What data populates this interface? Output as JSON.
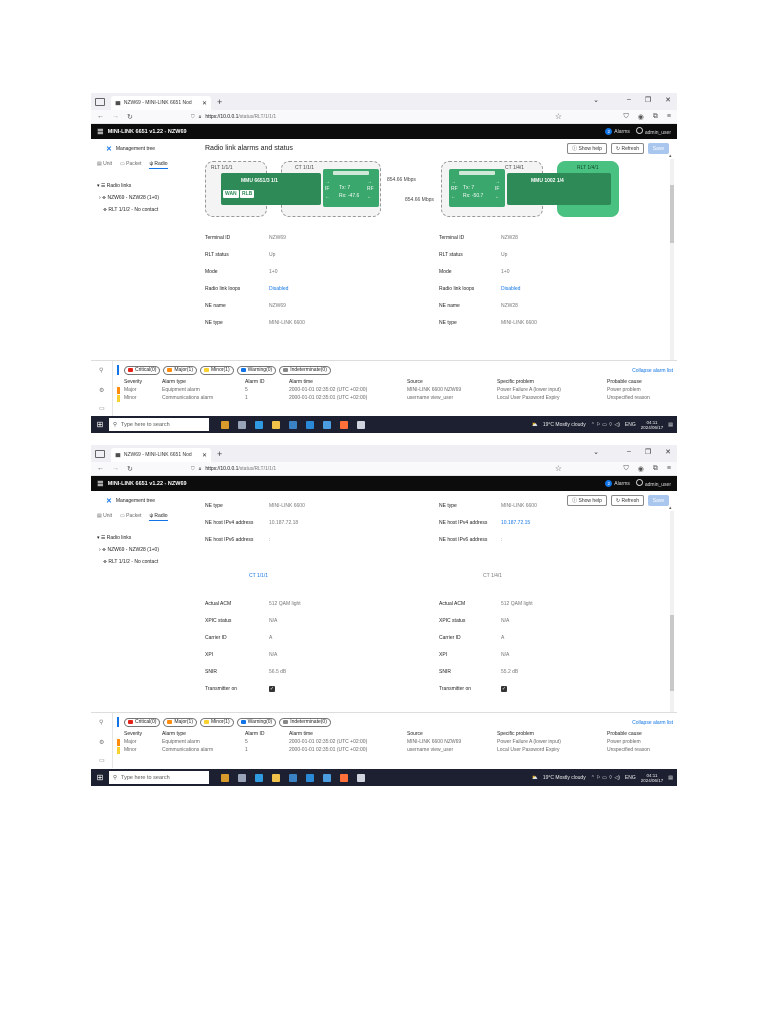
{
  "browser": {
    "tab_title": "NZW69 - MINI-LINK 6651 Nod",
    "url_host": "https://10.0.0.1",
    "url_path": "/status/RLT/1/1/1"
  },
  "app": {
    "logo": "≣",
    "title": "MINI-LINK 6651 v1.22 - NZW69",
    "alarms_label": "Alarms",
    "alarms_count": "2",
    "user": "admin_user"
  },
  "sidebar": {
    "management_tree": "Management tree",
    "tabs": [
      "Unit",
      "Packet",
      "Radio"
    ],
    "tree": [
      "Radio links",
      "NZW69 - NZW28 (1+0)",
      "RLT 1/1/2 - No contact"
    ]
  },
  "page": {
    "title": "Radio link alarms and status",
    "show_help": "Show help",
    "refresh": "Refresh",
    "save": "Save"
  },
  "diagram": {
    "rlt_left": "RLT 1/1/1",
    "ct_left": "CT 1/1/1",
    "mmu_left": "MMU 6651/3 1/1",
    "wan": "WAN",
    "rlb": "RLB",
    "if_l": "IF",
    "rf_l": "RF",
    "tx_left": "Tx: 7",
    "rx_left": "Rx: -47.6",
    "speed1": "854.66 Mbps",
    "speed2": "854.66 Mbps",
    "ct_right": "CT 1/4/1",
    "rlt_right": "RLT 1/4/1",
    "mmu_right": "MMU 1002 1/4",
    "rf_r": "RF",
    "if_r": "IF",
    "tx_right": "Tx: 7",
    "rx_right": "Rx: -50.7"
  },
  "status1": [
    {
      "k1": "Terminal ID",
      "v1": "NZW69",
      "k2": "Terminal ID",
      "v2": "NZW28"
    },
    {
      "k1": "RLT status",
      "v1": "Up",
      "k2": "RLT status",
      "v2": "Up"
    },
    {
      "k1": "Mode",
      "v1": "1+0",
      "k2": "Mode",
      "v2": "1+0"
    },
    {
      "k1": "Radio link loops",
      "v1": "Disabled",
      "k2": "Radio link loops",
      "v2": "Disabled"
    },
    {
      "k1": "NE name",
      "v1": "NZW69",
      "k2": "NE name",
      "v2": "NZW28"
    },
    {
      "k1": "NE type",
      "v1": "MINI-LINK 6600",
      "k2": "NE type",
      "v2": "MINI-LINK 6600"
    }
  ],
  "status2_top": [
    {
      "k1": "NE type",
      "v1": "MINI-LINK 6600",
      "k2": "NE type",
      "v2": "MINI-LINK 6600"
    },
    {
      "k1": "NE host IPv4 address",
      "v1": "10.187.72.18",
      "k2": "NE host IPv4 address",
      "v2": "10.187.72.15"
    },
    {
      "k1": "NE host IPv6 address",
      "v1": ":",
      "k2": "NE host IPv6 address",
      "v2": ":"
    }
  ],
  "ct_links": {
    "left": "CT 1/1/1",
    "right": "CT 1/4/1"
  },
  "status2_bottom": [
    {
      "k1": "Actual ACM",
      "v1": "512 QAM light",
      "k2": "Actual ACM",
      "v2": "512 QAM light"
    },
    {
      "k1": "XPIC status",
      "v1": "N/A",
      "k2": "XPIC status",
      "v2": "N/A"
    },
    {
      "k1": "Carrier ID",
      "v1": "A",
      "k2": "Carrier ID",
      "v2": "A"
    },
    {
      "k1": "XPI",
      "v1": "N/A",
      "k2": "XPI",
      "v2": "N/A"
    },
    {
      "k1": "SNIR",
      "v1": "56.5 dB",
      "k2": "SNIR",
      "v2": "55.2 dB"
    },
    {
      "k1": "Transmitter on",
      "v1": "",
      "k2": "Transmitter on",
      "v2": ""
    }
  ],
  "alarm_filters": [
    {
      "label": "Critical(0)",
      "color": "#e32219"
    },
    {
      "label": "Major(1)",
      "color": "#ff8c0a"
    },
    {
      "label": "Minor(1)",
      "color": "#fad22d"
    },
    {
      "label": "Warning(0)",
      "color": "#1174e6"
    },
    {
      "label": "Indeterminate(0)",
      "color": "#888888"
    }
  ],
  "collapse_label": "Collapse alarm list",
  "alarm_headers": [
    "Severity",
    "Alarm type",
    "Alarm ID",
    "Alarm time",
    "Source",
    "Specific problem",
    "Probable cause"
  ],
  "alarm_rows": [
    [
      "Major",
      "Equipment alarm",
      "5",
      "2000-01-01 02:35:02 (UTC +02:00)",
      "MINI-LINK 6600 NZW69",
      "Power Failure A (lower input)",
      "Power problem"
    ],
    [
      "Minor",
      "Communications alarm",
      "1",
      "2000-01-01 02:35:01 (UTC +02:00)",
      "username view_user",
      "Local User Password Expiry",
      "Unspecified reason"
    ]
  ],
  "taskbar": {
    "search": "Type here to search",
    "weather": "19°C Mostly cloudy",
    "lang": "ENG",
    "time": "04:11",
    "date": "2024/06/17"
  }
}
